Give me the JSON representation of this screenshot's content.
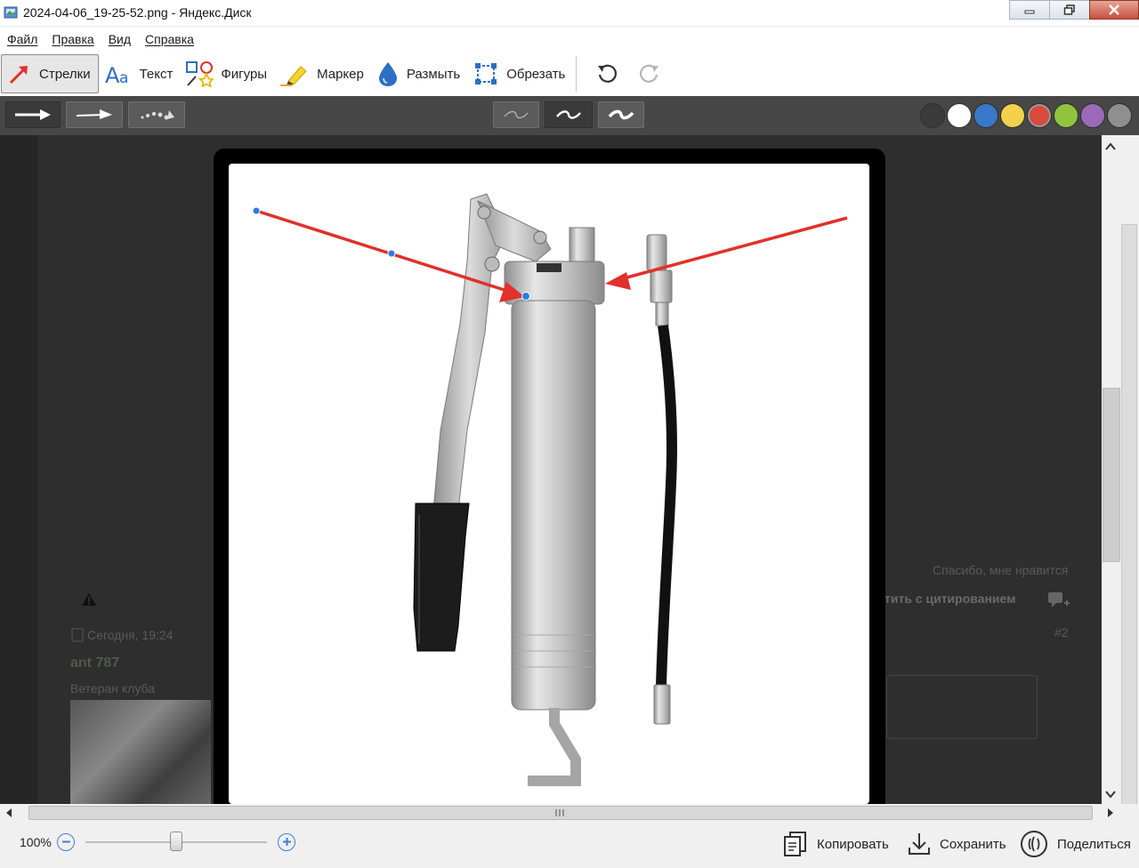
{
  "window": {
    "title": "2024-04-06_19-25-52.png - Яндекс.Диск"
  },
  "menu": [
    "Файл",
    "Правка",
    "Вид",
    "Справка"
  ],
  "toolbar": {
    "tools": [
      {
        "label": "Стрелки",
        "icon": "arrow-icon",
        "active": true
      },
      {
        "label": "Текст",
        "icon": "text-icon",
        "active": false
      },
      {
        "label": "Фигуры",
        "icon": "shapes-icon",
        "active": false
      },
      {
        "label": "Маркер",
        "icon": "marker-icon",
        "active": false
      },
      {
        "label": "Размыть",
        "icon": "blur-drop-icon",
        "active": false
      },
      {
        "label": "Обрезать",
        "icon": "crop-icon",
        "active": false
      }
    ],
    "undo_icon": "undo-icon",
    "redo_icon": "redo-icon"
  },
  "stylebar": {
    "arrow_styles": [
      "arrow-style-solid",
      "arrow-style-thin",
      "arrow-style-dotted"
    ],
    "line_widths": [
      "thin",
      "medium",
      "thick"
    ],
    "selected_width": "medium",
    "colors": [
      "#3a3a3a",
      "#ffffff",
      "#3a78c9",
      "#f2d24a",
      "#d9493c",
      "#8fc43c",
      "#9b6ab8",
      "#8f8f8f"
    ],
    "selected_color": "#d9493c"
  },
  "background": {
    "like_text": "Спасибо, мне нравится",
    "quote_text": "тить с цитированием",
    "date_text": "Сегодня, 19:24",
    "post_number": "#2",
    "username": "ant 787",
    "user_rank": "Ветеран клуба"
  },
  "annotation": {
    "arrow_color": "#e0312a",
    "arrows": 2
  },
  "status": {
    "zoom": "100%",
    "zoom_level": 0.5,
    "copy": "Копировать",
    "save": "Сохранить",
    "share": "Поделиться"
  }
}
